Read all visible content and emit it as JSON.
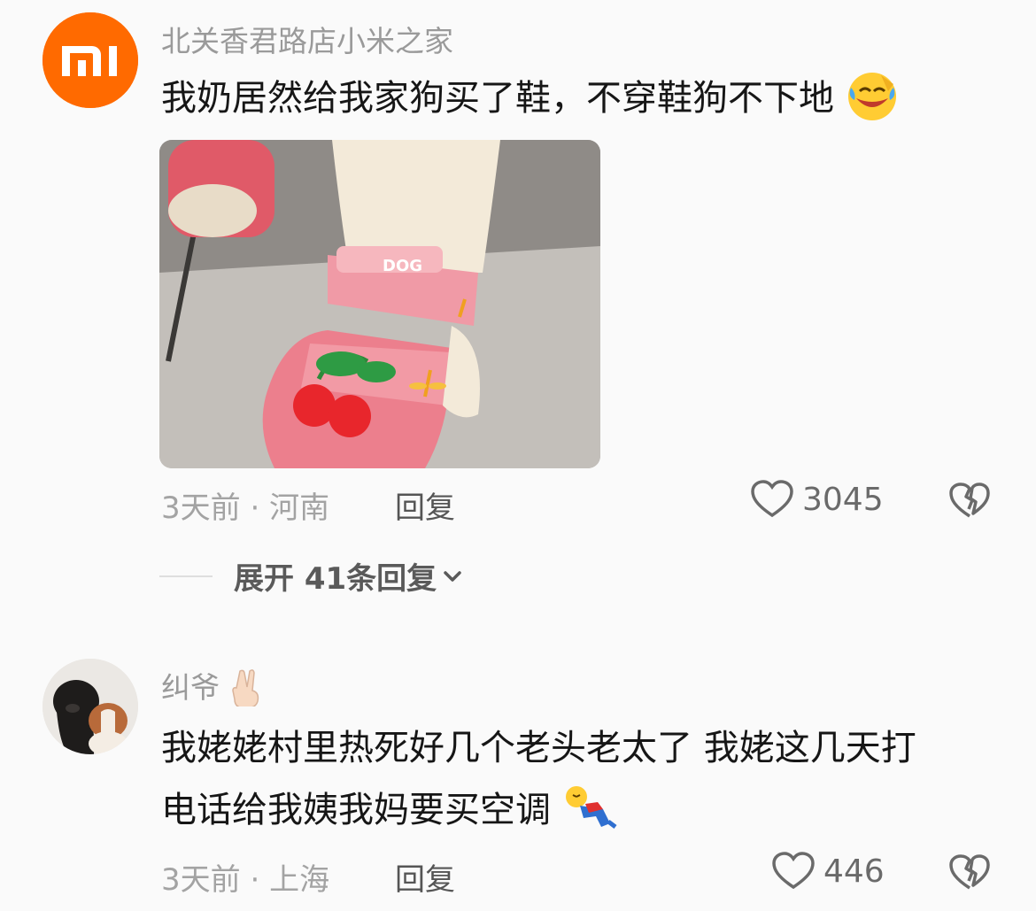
{
  "comments": [
    {
      "username": "北关香君路店小米之家",
      "avatar_icon": "xiaomi-logo",
      "text_lines": [
        "我奶居然给我家狗买了鞋，不穿鞋狗不下地"
      ],
      "text_emoji": "laughing-tears-emoji",
      "has_image": true,
      "image_description_icon": "dog-paw-pink-shoe-photo",
      "image_text": "DOG",
      "time": "3天前",
      "location": "河南",
      "reply_label": "回复",
      "likes": "3045",
      "expand_label": "展开 41条回复"
    },
    {
      "username": "纠爷",
      "username_emoji": "victory-hand-emoji",
      "avatar_icon": "dogs-photo-avatar",
      "text_lines": [
        "我姥姥村里热死好几个老头老太了 我姥这几天打",
        "电话给我姨我妈要买空调"
      ],
      "text_emoji": "fallen-person-emoji",
      "time": "3天前",
      "location": "上海",
      "reply_label": "回复",
      "likes": "446"
    }
  ],
  "meta_separator": "·",
  "colors": {
    "background": "#fafafa",
    "xiaomi_orange": "#ff6900",
    "muted_text": "#a3a3a3"
  }
}
